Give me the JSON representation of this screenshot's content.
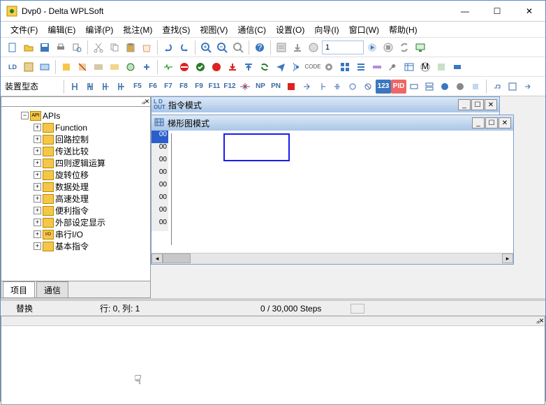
{
  "window": {
    "title": "Dvp0 - Delta WPLSoft"
  },
  "menu": {
    "file": "文件(F)",
    "edit": "编辑(E)",
    "compile": "编译(P)",
    "comment": "批注(M)",
    "search": "查找(S)",
    "view": "视图(V)",
    "comm": "通信(C)",
    "settings": "设置(O)",
    "wizard": "向导(I)",
    "window": "窗口(W)",
    "help": "帮助(H)"
  },
  "toolbar": {
    "program_input": "1"
  },
  "row2_label": "装置型态",
  "tree": {
    "root": "APIs",
    "items": [
      "Function",
      "回路控制",
      "传送比较",
      "四则逻辑运算",
      "旋转位移",
      "数据处理",
      "高速处理",
      "便利指令",
      "外部设定显示",
      "串行I/O",
      "基本指令"
    ]
  },
  "side_tabs": {
    "proj": "项目",
    "comm": "通信"
  },
  "child_instr": {
    "title": "指令模式"
  },
  "child_ladder": {
    "title": "梯形图模式",
    "rows": [
      "00",
      "00",
      "00",
      "00",
      "00",
      "00",
      "00",
      "00"
    ]
  },
  "status": {
    "replace": "替换",
    "rowcol": "行: 0, 列: 1",
    "steps": "0 / 30,000 Steps"
  }
}
